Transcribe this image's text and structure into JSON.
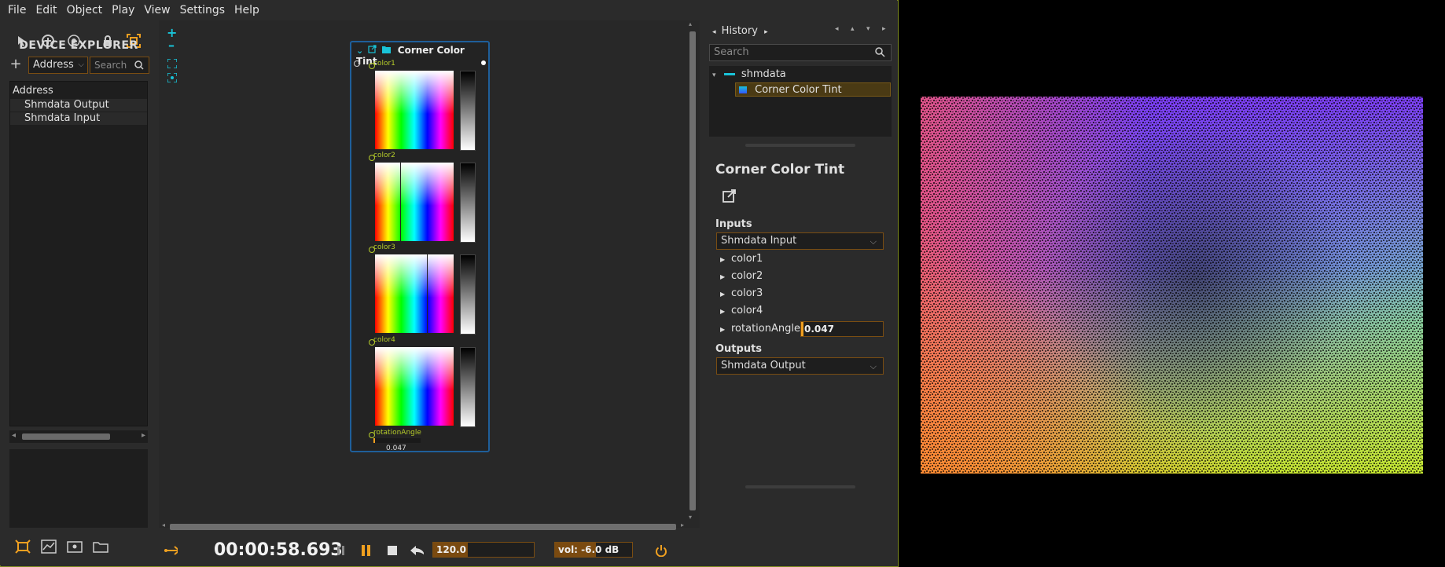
{
  "menubar": {
    "items": [
      "File",
      "Edit",
      "Object",
      "Play",
      "View",
      "Settings",
      "Help"
    ]
  },
  "device_explorer": {
    "title": "DEVICE EXPLORER",
    "address_select": "Address",
    "search_placeholder": "Search",
    "tree_header": "Address",
    "devices": [
      "Shmdata Output",
      "Shmdata Input"
    ]
  },
  "node": {
    "title": "Corner Color Tint",
    "ports": [
      "color1",
      "color2",
      "color3",
      "color4",
      "rotationAngle"
    ],
    "rotation_value": "0.047"
  },
  "transport": {
    "time": "00:00:58.693",
    "tempo": "120.0",
    "volume": "vol: -6.0 dB"
  },
  "history": {
    "title": "History",
    "search_placeholder": "Search",
    "root": "shmdata",
    "child": "Corner Color Tint"
  },
  "inspector": {
    "title": "Corner Color Tint",
    "inputs_label": "Inputs",
    "input_device": "Shmdata Input",
    "params": [
      "color1",
      "color2",
      "color3",
      "color4",
      "rotationAngle"
    ],
    "rotation_value": "0.047",
    "outputs_label": "Outputs",
    "output_device": "Shmdata Output"
  },
  "colors": {
    "accent": "#f0a020",
    "port": "#b6cc2a",
    "node_border": "#1f5f9a",
    "icon_cyan": "#19c3d8"
  }
}
